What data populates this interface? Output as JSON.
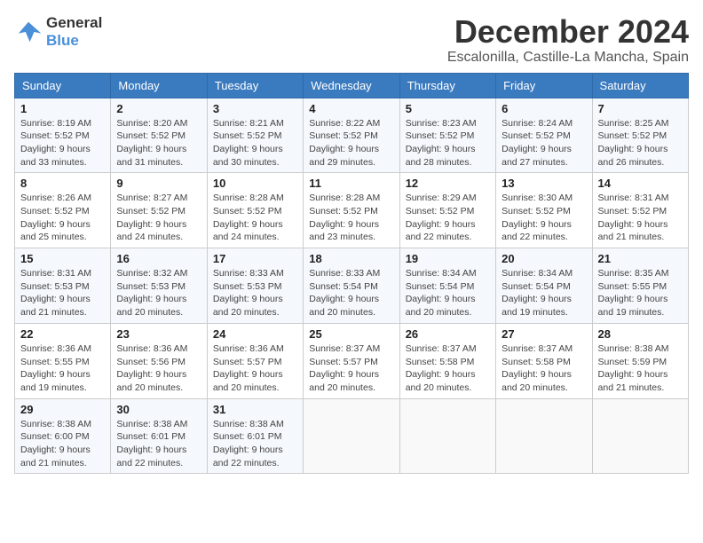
{
  "header": {
    "logo_line1": "General",
    "logo_line2": "Blue",
    "month_title": "December 2024",
    "location": "Escalonilla, Castille-La Mancha, Spain"
  },
  "weekdays": [
    "Sunday",
    "Monday",
    "Tuesday",
    "Wednesday",
    "Thursday",
    "Friday",
    "Saturday"
  ],
  "weeks": [
    [
      {
        "day": "1",
        "sunrise": "Sunrise: 8:19 AM",
        "sunset": "Sunset: 5:52 PM",
        "daylight": "Daylight: 9 hours and 33 minutes."
      },
      {
        "day": "2",
        "sunrise": "Sunrise: 8:20 AM",
        "sunset": "Sunset: 5:52 PM",
        "daylight": "Daylight: 9 hours and 31 minutes."
      },
      {
        "day": "3",
        "sunrise": "Sunrise: 8:21 AM",
        "sunset": "Sunset: 5:52 PM",
        "daylight": "Daylight: 9 hours and 30 minutes."
      },
      {
        "day": "4",
        "sunrise": "Sunrise: 8:22 AM",
        "sunset": "Sunset: 5:52 PM",
        "daylight": "Daylight: 9 hours and 29 minutes."
      },
      {
        "day": "5",
        "sunrise": "Sunrise: 8:23 AM",
        "sunset": "Sunset: 5:52 PM",
        "daylight": "Daylight: 9 hours and 28 minutes."
      },
      {
        "day": "6",
        "sunrise": "Sunrise: 8:24 AM",
        "sunset": "Sunset: 5:52 PM",
        "daylight": "Daylight: 9 hours and 27 minutes."
      },
      {
        "day": "7",
        "sunrise": "Sunrise: 8:25 AM",
        "sunset": "Sunset: 5:52 PM",
        "daylight": "Daylight: 9 hours and 26 minutes."
      }
    ],
    [
      {
        "day": "8",
        "sunrise": "Sunrise: 8:26 AM",
        "sunset": "Sunset: 5:52 PM",
        "daylight": "Daylight: 9 hours and 25 minutes."
      },
      {
        "day": "9",
        "sunrise": "Sunrise: 8:27 AM",
        "sunset": "Sunset: 5:52 PM",
        "daylight": "Daylight: 9 hours and 24 minutes."
      },
      {
        "day": "10",
        "sunrise": "Sunrise: 8:28 AM",
        "sunset": "Sunset: 5:52 PM",
        "daylight": "Daylight: 9 hours and 24 minutes."
      },
      {
        "day": "11",
        "sunrise": "Sunrise: 8:28 AM",
        "sunset": "Sunset: 5:52 PM",
        "daylight": "Daylight: 9 hours and 23 minutes."
      },
      {
        "day": "12",
        "sunrise": "Sunrise: 8:29 AM",
        "sunset": "Sunset: 5:52 PM",
        "daylight": "Daylight: 9 hours and 22 minutes."
      },
      {
        "day": "13",
        "sunrise": "Sunrise: 8:30 AM",
        "sunset": "Sunset: 5:52 PM",
        "daylight": "Daylight: 9 hours and 22 minutes."
      },
      {
        "day": "14",
        "sunrise": "Sunrise: 8:31 AM",
        "sunset": "Sunset: 5:52 PM",
        "daylight": "Daylight: 9 hours and 21 minutes."
      }
    ],
    [
      {
        "day": "15",
        "sunrise": "Sunrise: 8:31 AM",
        "sunset": "Sunset: 5:53 PM",
        "daylight": "Daylight: 9 hours and 21 minutes."
      },
      {
        "day": "16",
        "sunrise": "Sunrise: 8:32 AM",
        "sunset": "Sunset: 5:53 PM",
        "daylight": "Daylight: 9 hours and 20 minutes."
      },
      {
        "day": "17",
        "sunrise": "Sunrise: 8:33 AM",
        "sunset": "Sunset: 5:53 PM",
        "daylight": "Daylight: 9 hours and 20 minutes."
      },
      {
        "day": "18",
        "sunrise": "Sunrise: 8:33 AM",
        "sunset": "Sunset: 5:54 PM",
        "daylight": "Daylight: 9 hours and 20 minutes."
      },
      {
        "day": "19",
        "sunrise": "Sunrise: 8:34 AM",
        "sunset": "Sunset: 5:54 PM",
        "daylight": "Daylight: 9 hours and 20 minutes."
      },
      {
        "day": "20",
        "sunrise": "Sunrise: 8:34 AM",
        "sunset": "Sunset: 5:54 PM",
        "daylight": "Daylight: 9 hours and 19 minutes."
      },
      {
        "day": "21",
        "sunrise": "Sunrise: 8:35 AM",
        "sunset": "Sunset: 5:55 PM",
        "daylight": "Daylight: 9 hours and 19 minutes."
      }
    ],
    [
      {
        "day": "22",
        "sunrise": "Sunrise: 8:36 AM",
        "sunset": "Sunset: 5:55 PM",
        "daylight": "Daylight: 9 hours and 19 minutes."
      },
      {
        "day": "23",
        "sunrise": "Sunrise: 8:36 AM",
        "sunset": "Sunset: 5:56 PM",
        "daylight": "Daylight: 9 hours and 20 minutes."
      },
      {
        "day": "24",
        "sunrise": "Sunrise: 8:36 AM",
        "sunset": "Sunset: 5:57 PM",
        "daylight": "Daylight: 9 hours and 20 minutes."
      },
      {
        "day": "25",
        "sunrise": "Sunrise: 8:37 AM",
        "sunset": "Sunset: 5:57 PM",
        "daylight": "Daylight: 9 hours and 20 minutes."
      },
      {
        "day": "26",
        "sunrise": "Sunrise: 8:37 AM",
        "sunset": "Sunset: 5:58 PM",
        "daylight": "Daylight: 9 hours and 20 minutes."
      },
      {
        "day": "27",
        "sunrise": "Sunrise: 8:37 AM",
        "sunset": "Sunset: 5:58 PM",
        "daylight": "Daylight: 9 hours and 20 minutes."
      },
      {
        "day": "28",
        "sunrise": "Sunrise: 8:38 AM",
        "sunset": "Sunset: 5:59 PM",
        "daylight": "Daylight: 9 hours and 21 minutes."
      }
    ],
    [
      {
        "day": "29",
        "sunrise": "Sunrise: 8:38 AM",
        "sunset": "Sunset: 6:00 PM",
        "daylight": "Daylight: 9 hours and 21 minutes."
      },
      {
        "day": "30",
        "sunrise": "Sunrise: 8:38 AM",
        "sunset": "Sunset: 6:01 PM",
        "daylight": "Daylight: 9 hours and 22 minutes."
      },
      {
        "day": "31",
        "sunrise": "Sunrise: 8:38 AM",
        "sunset": "Sunset: 6:01 PM",
        "daylight": "Daylight: 9 hours and 22 minutes."
      },
      null,
      null,
      null,
      null
    ]
  ]
}
